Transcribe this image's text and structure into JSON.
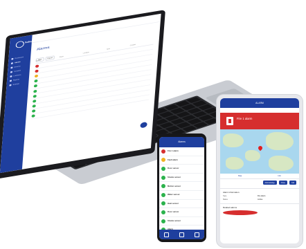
{
  "colors": {
    "brand": "#1f3f9e",
    "alarm": "#d62e2e",
    "ok": "#2bb24c",
    "warning": "#f0b323"
  },
  "laptop": {
    "brand": "Safeq",
    "page_title": "Alarms",
    "toolbar": [
      "Filter",
      "Export"
    ],
    "nav_items": [
      {
        "label": "Dashboard",
        "icon": "dashboard-icon"
      },
      {
        "label": "Alarms",
        "icon": "bell-icon"
      },
      {
        "label": "Devices",
        "icon": "device-icon"
      },
      {
        "label": "Contacts",
        "icon": "contacts-icon"
      },
      {
        "label": "Locations",
        "icon": "location-icon"
      },
      {
        "label": "Reports",
        "icon": "chart-icon"
      },
      {
        "label": "Settings",
        "icon": "gear-icon"
      }
    ],
    "table_headers": [
      "Status",
      "Alarm",
      "Location",
      "Time",
      "Contact"
    ],
    "rows": [
      {
        "status": "alarm"
      },
      {
        "status": "alarm"
      },
      {
        "status": "warning"
      },
      {
        "status": "ok"
      },
      {
        "status": "ok"
      },
      {
        "status": "ok"
      },
      {
        "status": "ok"
      },
      {
        "status": "ok"
      },
      {
        "status": "ok"
      },
      {
        "status": "ok"
      },
      {
        "status": "ok"
      }
    ]
  },
  "phone": {
    "header": "Alarms",
    "items": [
      {
        "status": "alarm",
        "title": "Fire 1 alarm"
      },
      {
        "status": "warning",
        "title": "Fault alarm"
      },
      {
        "status": "ok",
        "title": "Door sensor"
      },
      {
        "status": "ok",
        "title": "Smoke sensor"
      },
      {
        "status": "ok",
        "title": "Motion sensor"
      },
      {
        "status": "ok",
        "title": "Water sensor"
      },
      {
        "status": "ok",
        "title": "Heat sensor"
      },
      {
        "status": "ok",
        "title": "Door sensor"
      },
      {
        "status": "ok",
        "title": "Smoke sensor"
      },
      {
        "status": "ok",
        "title": "Alarm"
      },
      {
        "status": "ok",
        "title": "Alarm"
      }
    ]
  },
  "tablet": {
    "header": "ALARM",
    "banner_title": "Fire 1 alarm",
    "map_tabs": [
      "Map",
      "Info"
    ],
    "actions": [
      "Acknowledge",
      "Close",
      "Call"
    ],
    "section_title": "Alarm information",
    "kv": [
      {
        "k": "Type",
        "v": "Fire alarm"
      },
      {
        "k": "Status",
        "v": "Active"
      }
    ],
    "section2_title": "Related alarms"
  }
}
